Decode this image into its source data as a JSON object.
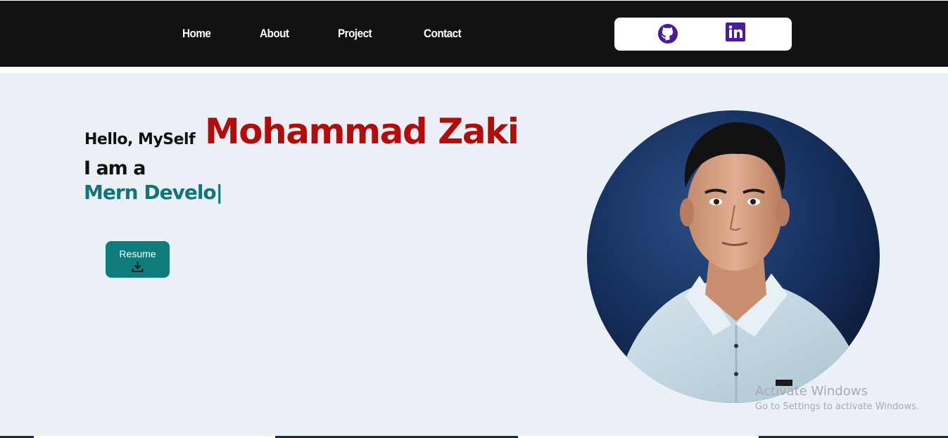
{
  "nav": {
    "links": [
      "Home",
      "About",
      "Project",
      "Contact"
    ]
  },
  "social": {
    "icons": [
      "github-icon",
      "linkedin-icon"
    ],
    "icon_color": "#4a1c9c"
  },
  "hero": {
    "greeting": "Hello, MySelf",
    "name": "Mohammad Zaki",
    "intro": "I am a",
    "role_typed": "Mern Develo|",
    "resume_label": "Resume",
    "resume_icon": "download-icon"
  },
  "watermark": {
    "title": "Activate Windows",
    "subtitle": "Go to Settings to activate Windows."
  },
  "colors": {
    "navbar_bg": "#121212",
    "hero_bg": "#ebf0f7",
    "name_color": "#b00d0d",
    "role_color": "#137377",
    "button_bg": "#0e7c7c"
  }
}
